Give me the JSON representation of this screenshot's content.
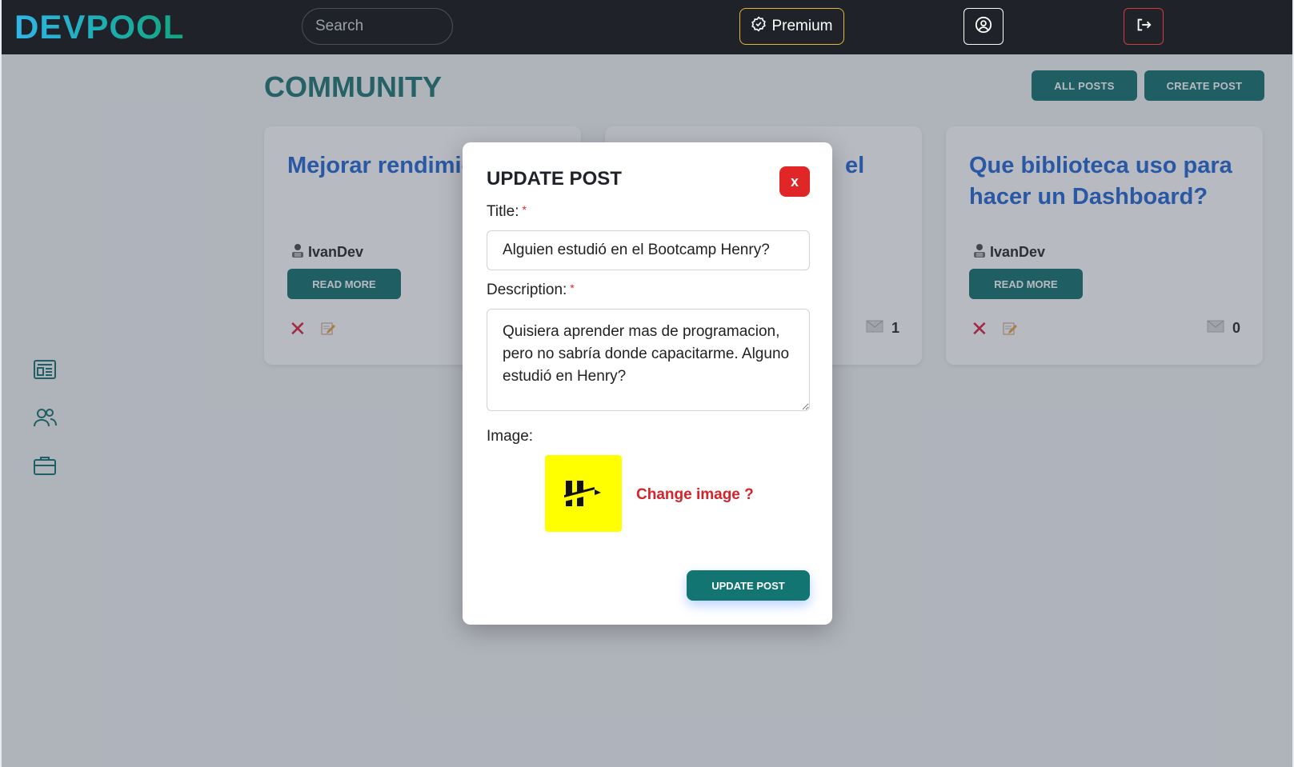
{
  "topbar": {
    "logo": "DEVPOOL",
    "search_placeholder": "Search",
    "premium_label": "Premium"
  },
  "main": {
    "title": "COMMUNITY",
    "all_posts_label": "ALL POSTS",
    "create_post_label": "CREATE POST"
  },
  "cards": [
    {
      "title": "Mejorar rendimiento App",
      "author": "IvanDev",
      "read_more": "READ MORE",
      "messages": ""
    },
    {
      "title": "el",
      "author": "",
      "read_more": "",
      "messages": "1"
    },
    {
      "title": "Que biblioteca uso para hacer un Dashboard?",
      "author": "IvanDev",
      "read_more": "READ MORE",
      "messages": "0"
    }
  ],
  "modal": {
    "title": "UPDATE POST",
    "close_label": "x",
    "title_label": "Title:",
    "required_mark": "*",
    "title_value": "Alguien estudió en el Bootcamp Henry?",
    "description_label": "Description:",
    "description_value": "Quisiera aprender mas de programacion, pero no sabría donde capacitarme. Alguno estudió en Henry?",
    "image_label": "Image:",
    "change_image_label": "Change image ?",
    "submit_label": "UPDATE POST"
  },
  "colors": {
    "accent": "#1f7a78",
    "title_blue": "#2f6fd6",
    "danger": "#e02626",
    "premium_border": "#e2b63a"
  }
}
